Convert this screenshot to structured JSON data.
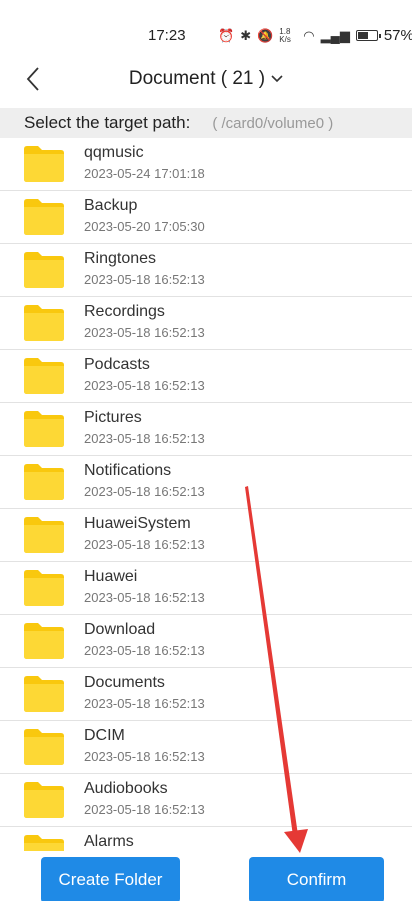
{
  "status_bar": {
    "time": "17:23",
    "net_speed": "1.8 K/s",
    "battery_percent": "57%",
    "battery_level": 0.57
  },
  "header": {
    "title": "Document ( 21 )",
    "back_icon": "chevron-left-icon",
    "dropdown_icon": "chevron-down-icon"
  },
  "path_bar": {
    "label": "Select the target path:",
    "value": "( /card0/volume0 )"
  },
  "folders": [
    {
      "name": "qqmusic",
      "date": "2023-05-24 17:01:18"
    },
    {
      "name": "Backup",
      "date": "2023-05-20 17:05:30"
    },
    {
      "name": "Ringtones",
      "date": "2023-05-18 16:52:13"
    },
    {
      "name": "Recordings",
      "date": "2023-05-18 16:52:13"
    },
    {
      "name": "Podcasts",
      "date": "2023-05-18 16:52:13"
    },
    {
      "name": "Pictures",
      "date": "2023-05-18 16:52:13"
    },
    {
      "name": "Notifications",
      "date": "2023-05-18 16:52:13"
    },
    {
      "name": "HuaweiSystem",
      "date": "2023-05-18 16:52:13"
    },
    {
      "name": "Huawei",
      "date": "2023-05-18 16:52:13"
    },
    {
      "name": "Download",
      "date": "2023-05-18 16:52:13"
    },
    {
      "name": "Documents",
      "date": "2023-05-18 16:52:13"
    },
    {
      "name": "DCIM",
      "date": "2023-05-18 16:52:13"
    },
    {
      "name": "Audiobooks",
      "date": "2023-05-18 16:52:13"
    },
    {
      "name": "Alarms",
      "date": ""
    }
  ],
  "buttons": {
    "create_folder": "Create Folder",
    "confirm": "Confirm"
  },
  "colors": {
    "accent": "#1f8ae6",
    "folder": "#fdd835",
    "annotation": "#e53935"
  }
}
